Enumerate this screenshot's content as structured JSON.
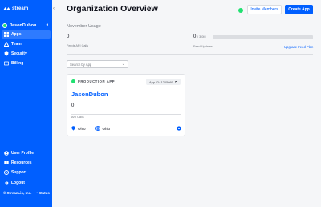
{
  "sidebar": {
    "logo_text": "stream",
    "org_name": "JasonDubon",
    "items": [
      {
        "label": "Apps",
        "icon": "apps-icon"
      },
      {
        "label": "Team",
        "icon": "team-icon"
      },
      {
        "label": "Security",
        "icon": "shield-icon"
      },
      {
        "label": "Billing",
        "icon": "credit-card-icon"
      },
      {
        "label": "User Profile",
        "icon": "user-icon"
      },
      {
        "label": "Resources",
        "icon": "book-icon"
      },
      {
        "label": "Support",
        "icon": "lifebuoy-icon"
      },
      {
        "label": "Logout",
        "icon": "logout-icon"
      }
    ],
    "footer_brand": "© Stream.io, Inc.",
    "footer_status": "• Status"
  },
  "header": {
    "title": "Organization Overview",
    "invite_label": "Invite Members",
    "create_label": "Create App"
  },
  "usage": {
    "month_label": "November Usage",
    "api_calls_value": "0",
    "api_calls_label": "Feeds API Calls",
    "feed_updates_value": "0",
    "feed_updates_limit": "/ 3.0M",
    "feed_updates_label": "Feed Updates",
    "feed_updates_fraction": 0,
    "upgrade_label": "Upgrade Feed Plan"
  },
  "search": {
    "placeholder": "Search by App"
  },
  "app_card": {
    "environment": "PRODUCTION APP",
    "app_id": "App ID: 1265091",
    "name": "JasonDubon",
    "api_calls_value": "0",
    "api_calls_label": "API Calls",
    "region_1": "Ohio",
    "region_2": "Ohio"
  },
  "colors": {
    "brand": "#005fff",
    "status_green": "#20e070"
  }
}
